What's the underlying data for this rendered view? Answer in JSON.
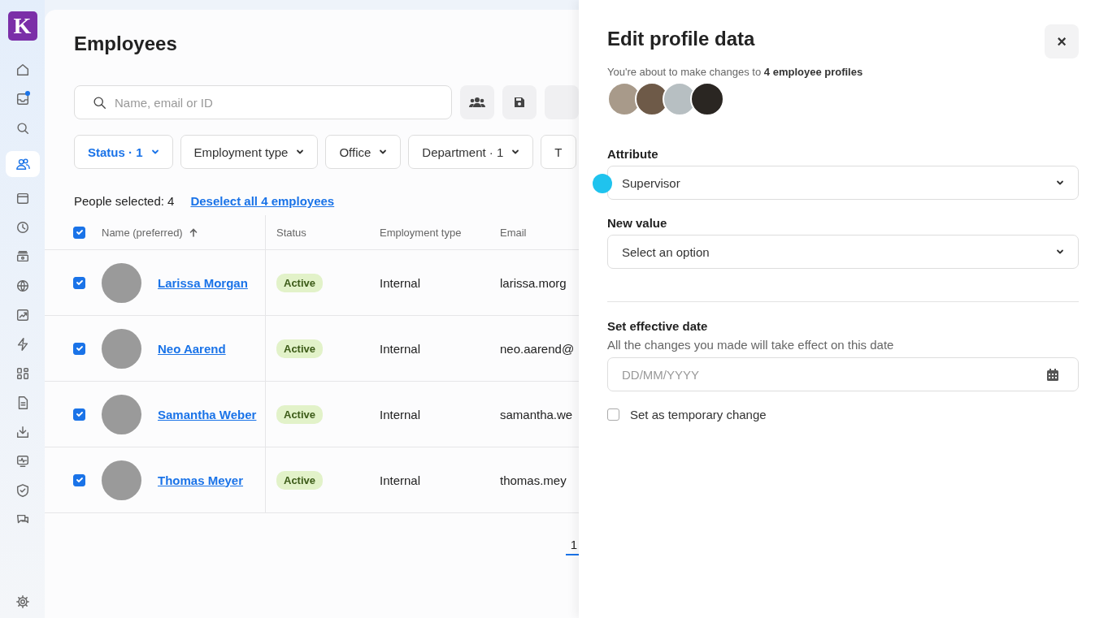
{
  "sidebar": {
    "logo": "K",
    "items": [
      {
        "kind": "home",
        "selected": false,
        "badge": false
      },
      {
        "kind": "inbox",
        "selected": false,
        "badge": true
      },
      {
        "kind": "search",
        "selected": false,
        "badge": false
      },
      {
        "kind": "people",
        "selected": true,
        "badge": false
      },
      {
        "kind": "calendar",
        "selected": false,
        "badge": false
      },
      {
        "kind": "clock",
        "selected": false,
        "badge": false
      },
      {
        "kind": "cash",
        "selected": false,
        "badge": false
      },
      {
        "kind": "globe",
        "selected": false,
        "badge": false
      },
      {
        "kind": "chart",
        "selected": false,
        "badge": false
      },
      {
        "kind": "bolt",
        "selected": false,
        "badge": false
      },
      {
        "kind": "apps",
        "selected": false,
        "badge": false
      },
      {
        "kind": "document",
        "selected": false,
        "badge": false
      },
      {
        "kind": "download",
        "selected": false,
        "badge": false
      },
      {
        "kind": "pulse",
        "selected": false,
        "badge": false
      },
      {
        "kind": "shield",
        "selected": false,
        "badge": false
      },
      {
        "kind": "chat",
        "selected": false,
        "badge": false
      }
    ],
    "bottom": [
      {
        "kind": "settings",
        "selected": false,
        "badge": false
      }
    ]
  },
  "page": {
    "title": "Employees"
  },
  "search": {
    "placeholder": "Name, email or ID"
  },
  "filters": [
    {
      "label": "Status · 1",
      "selected": true
    },
    {
      "label": "Employment type",
      "selected": false
    },
    {
      "label": "Office",
      "selected": false
    },
    {
      "label": "Department · 1",
      "selected": false
    },
    {
      "label": "T",
      "selected": false
    }
  ],
  "selection": {
    "text": "People selected: 4",
    "link": "Deselect all 4 employees"
  },
  "table": {
    "all_checked": true,
    "columns": [
      "Name (preferred)",
      "Status",
      "Employment type",
      "Email"
    ],
    "rows": [
      {
        "checked": true,
        "name": "Larissa Morgan",
        "status": "Active",
        "type": "Internal",
        "email": "larissa.morg"
      },
      {
        "checked": true,
        "name": "Neo Aarend",
        "status": "Active",
        "type": "Internal",
        "email": "neo.aarend@"
      },
      {
        "checked": true,
        "name": "Samantha Weber",
        "status": "Active",
        "type": "Internal",
        "email": "samantha.we"
      },
      {
        "checked": true,
        "name": "Thomas Meyer",
        "status": "Active",
        "type": "Internal",
        "email": "thomas.mey"
      }
    ]
  },
  "pagination": [
    {
      "label": "1",
      "selected": true
    }
  ],
  "panel": {
    "title": "Edit profile data",
    "close": "×",
    "intro": "You're about to make changes to **4 employee profiles**",
    "attribute": {
      "label": "Attribute",
      "value": "Supervisor"
    },
    "new_value": {
      "label": "New value",
      "placeholder": "Select an option"
    },
    "date": {
      "label": "Set effective date",
      "hint": "All the changes you made will take effect on this date",
      "placeholder": "DD/MM/YYYY"
    },
    "temporary": {
      "label": "Set as temporary change",
      "checked": false
    }
  }
}
